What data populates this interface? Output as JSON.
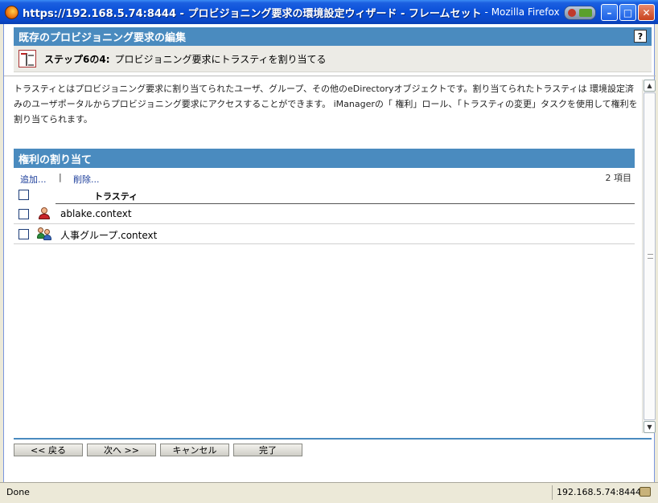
{
  "window": {
    "title": "https://192.168.5.74:8444 - プロビジョニング要求の環境設定ウィザード - フレームセット",
    "app_name": "- Mozilla Firefox",
    "min_label": "–",
    "max_label": "□",
    "close_label": "✕"
  },
  "header": {
    "title": "既存のプロビジョニング要求の編集",
    "help_label": "?"
  },
  "step": {
    "label": "ステップ6の4:",
    "text": "プロビジョニング要求にトラスティを割り当てる"
  },
  "description": "トラスティとはプロビジョニング要求に割り当てられたユーザ、グループ、その他のeDirectoryオブジェクトです。割り当てられたトラスティは 環境設定済みのユーザポータルからプロビジョニング要求にアクセスすることができます。 iManagerの「 権利」ロール、「トラスティの変更」タスクを使用して権利を割り当てられます。",
  "section": {
    "title": "権利の割り当て",
    "add_label": "追加...",
    "separator": "|",
    "delete_label": "削除...",
    "count": "2 項目",
    "column_trustee": "トラスティ"
  },
  "rows": [
    {
      "name": "ablake.context",
      "icon": "user-icon"
    },
    {
      "name": "人事グループ.context",
      "icon": "group-icon"
    }
  ],
  "buttons": {
    "back": "<< 戻る",
    "next": "次へ >>",
    "cancel": "キャンセル",
    "finish": "完了"
  },
  "status": {
    "text": "Done",
    "host": "192.168.5.74:8444"
  },
  "colors": {
    "accent": "#4a8bbf",
    "titlebar": "#0a4fd8"
  }
}
